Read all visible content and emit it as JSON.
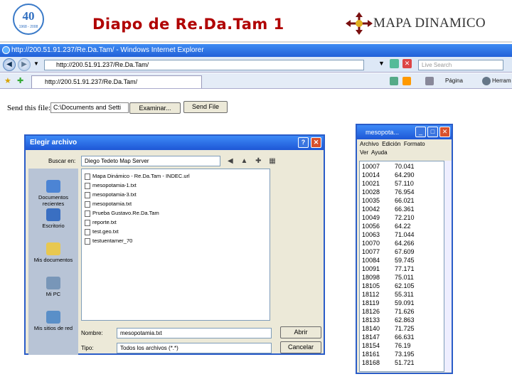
{
  "slide": {
    "title": "Diapo de Re.Da.Tam 1",
    "logo_number": "40",
    "logo_small": "1968 - 2008",
    "brand": "MAPA DINAMICO"
  },
  "browser": {
    "window_title": "http://200.51.91.237/Re.Da.Tam/ - Windows Internet Explorer",
    "address": "http://200.51.91.237/Re.Da.Tam/",
    "search_placeholder": "Live Search",
    "tab_label": "http://200.51.91.237/Re.Da.Tam/",
    "page_label": "Página",
    "tools_label": "Herram",
    "send_label": "Send this file:",
    "file_value": "C:\\Documents and Setti",
    "browse_label": "Examinar...",
    "send_button": "Send File"
  },
  "dialog": {
    "title": "Elegir archivo",
    "look_in_label": "Buscar en:",
    "look_in_value": "Diego Tedeto Map Server",
    "places": [
      "Documentos recientes",
      "Escritorio",
      "Mis documentos",
      "Mi PC",
      "Mis sitios de red"
    ],
    "files": [
      "Mapa Dinámico - Re.Da.Tam - INDEC.url",
      "mesopotamia-1.txt",
      "mesopotamia-3.txt",
      "mesopotamia.txt",
      "Prueba Gustavo.Re.Da.Tam",
      "reporte.txt",
      "test.geo.txt",
      "testuentamer_70"
    ],
    "filename_label": "Nombre:",
    "filename_value": "mesopotamia.txt",
    "filetype_label": "Tipo:",
    "filetype_value": "Todos los archivos (*.*)",
    "open_button": "Abrir",
    "cancel_button": "Cancelar"
  },
  "notepad": {
    "title": "mesopota...",
    "menu": [
      "Archivo",
      "Edición",
      "Formato",
      "Ver",
      "Ayuda"
    ],
    "rows": [
      [
        "10007",
        "70.041"
      ],
      [
        "10014",
        "64.290"
      ],
      [
        "10021",
        "57.110"
      ],
      [
        "10028",
        "76.954"
      ],
      [
        "10035",
        "66.021"
      ],
      [
        "10042",
        "66.361"
      ],
      [
        "10049",
        "72.210"
      ],
      [
        "10056",
        "64.22"
      ],
      [
        "10063",
        "71.044"
      ],
      [
        "10070",
        "64.266"
      ],
      [
        "10077",
        "67.609"
      ],
      [
        "10084",
        "59.745"
      ],
      [
        "10091",
        "77.171"
      ],
      [
        "18098",
        "75.011"
      ],
      [
        "18105",
        "62.105"
      ],
      [
        "18112",
        "55.311"
      ],
      [
        "18119",
        "59.091"
      ],
      [
        "18126",
        "71.626"
      ],
      [
        "18133",
        "62.863"
      ],
      [
        "18140",
        "71.725"
      ],
      [
        "18147",
        "66.631"
      ],
      [
        "18154",
        "76.19"
      ],
      [
        "18161",
        "73.195"
      ],
      [
        "18168",
        "51.721"
      ]
    ]
  }
}
